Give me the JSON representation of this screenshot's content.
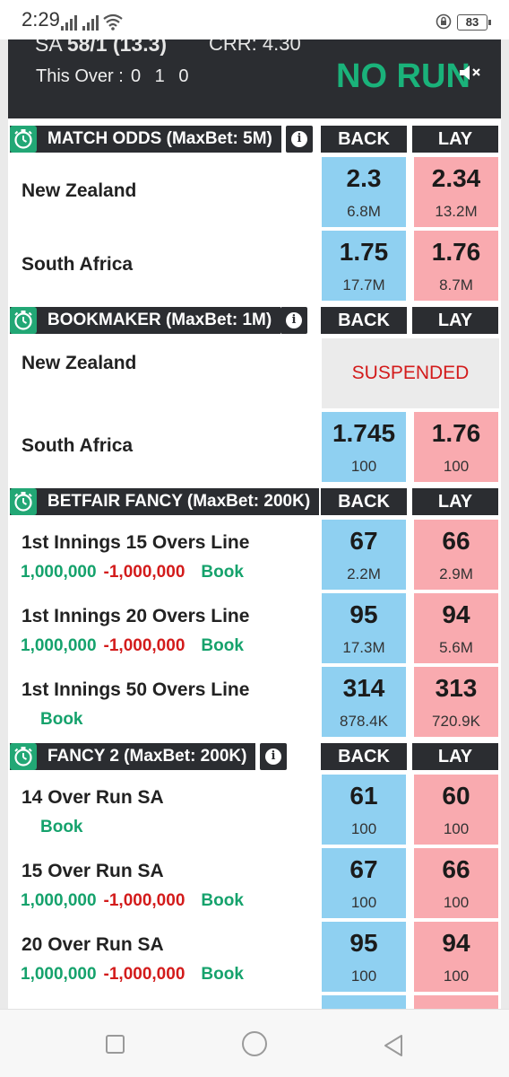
{
  "status_bar": {
    "time": "2:29",
    "battery": "83"
  },
  "scorecard": {
    "team": "SA",
    "score": "58/1 (13.3)",
    "crr": "CRR: 4.30",
    "this_over_label": "This Over :",
    "this_over_balls": "0 1 0",
    "status": "NO RUN"
  },
  "columns": {
    "back": "BACK",
    "lay": "LAY"
  },
  "markets": [
    {
      "title": "MATCH ODDS (MaxBet: 5M)",
      "rows": [
        {
          "runner": "New Zealand",
          "back_price": "2.3",
          "back_size": "6.8M",
          "lay_price": "2.34",
          "lay_size": "13.2M"
        },
        {
          "runner": "South Africa",
          "back_price": "1.75",
          "back_size": "17.7M",
          "lay_price": "1.76",
          "lay_size": "8.7M"
        }
      ]
    },
    {
      "title": "BOOKMAKER (MaxBet: 1M)",
      "rows": [
        {
          "runner": "New Zealand",
          "suspended": "SUSPENDED"
        },
        {
          "runner": "South Africa",
          "back_price": "1.745",
          "back_size": "100",
          "lay_price": "1.76",
          "lay_size": "100"
        }
      ]
    },
    {
      "title": "BETFAIR FANCY (MaxBet: 200K)",
      "rows": [
        {
          "runner": "1st Innings 15 Overs Line",
          "plus": "1,000,000",
          "minus": "-1,000,000",
          "book": "Book",
          "back_price": "67",
          "back_size": "2.2M",
          "lay_price": "66",
          "lay_size": "2.9M"
        },
        {
          "runner": "1st Innings 20 Overs Line",
          "plus": "1,000,000",
          "minus": "-1,000,000",
          "book": "Book",
          "back_price": "95",
          "back_size": "17.3M",
          "lay_price": "94",
          "lay_size": "5.6M"
        },
        {
          "runner": "1st Innings 50 Overs Line",
          "book": "Book",
          "back_price": "314",
          "back_size": "878.4K",
          "lay_price": "313",
          "lay_size": "720.9K"
        }
      ]
    },
    {
      "title": "FANCY 2 (MaxBet: 200K)",
      "rows": [
        {
          "runner": "14 Over Run SA",
          "book": "Book",
          "back_price": "61",
          "back_size": "100",
          "lay_price": "60",
          "lay_size": "100"
        },
        {
          "runner": "15 Over Run SA",
          "plus": "1,000,000",
          "minus": "-1,000,000",
          "book": "Book",
          "back_price": "67",
          "back_size": "100",
          "lay_price": "66",
          "lay_size": "100"
        },
        {
          "runner": "20 Over Run SA",
          "plus": "1,000,000",
          "minus": "-1,000,000",
          "book": "Book",
          "back_price": "95",
          "back_size": "100",
          "lay_price": "94",
          "lay_size": "100"
        }
      ]
    }
  ],
  "colors": {
    "back": "#8fd0f1",
    "lay": "#f9aaaf",
    "header": "#2b2d31",
    "accent": "#22a775",
    "negative": "#d31b1b"
  },
  "icons": {
    "timer": "stopwatch-icon",
    "info": "info-icon",
    "mute": "speaker-mute-icon"
  }
}
